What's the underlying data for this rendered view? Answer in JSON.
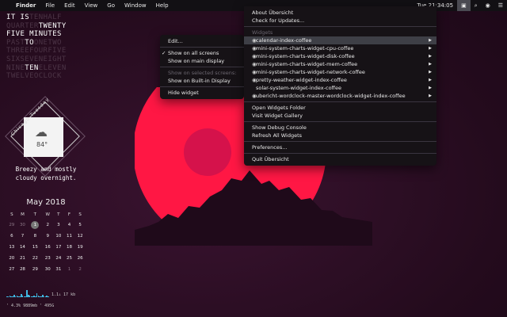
{
  "menubar": {
    "app": "Finder",
    "items": [
      "File",
      "Edit",
      "View",
      "Go",
      "Window",
      "Help"
    ],
    "clock": "Tue 21:34:05"
  },
  "wordclock": {
    "rows": [
      [
        {
          "t": "IT",
          "on": true
        },
        {
          "t": " ",
          "on": false
        },
        {
          "t": "IS",
          "on": true
        },
        {
          "t": "TENHALF",
          "on": false
        }
      ],
      [
        {
          "t": "QUARTER",
          "on": false
        },
        {
          "t": "TWENTY",
          "on": true
        }
      ],
      [
        {
          "t": "FIVE",
          "on": true
        },
        {
          "t": " ",
          "on": false
        },
        {
          "t": "MINUTES",
          "on": true
        }
      ],
      [
        {
          "t": "PAST",
          "on": false
        },
        {
          "t": "TO",
          "on": true
        },
        {
          "t": "ONETWO",
          "on": false
        }
      ],
      [
        {
          "t": "THREEFOURFIVE",
          "on": false
        }
      ],
      [
        {
          "t": "SIXSEVENEIGHT",
          "on": false
        }
      ],
      [
        {
          "t": "NINE",
          "on": false
        },
        {
          "t": "TEN",
          "on": true
        },
        {
          "t": "ELEVEN",
          "on": false
        }
      ],
      [
        {
          "t": "TWELVEOCLOCK",
          "on": false
        }
      ]
    ]
  },
  "weather": {
    "city": "Chicago Tuesday",
    "temp": "84°",
    "summary_line1": "Breezy and mostly",
    "summary_line2": "cloudy overnight."
  },
  "calendar": {
    "title": "May 2018",
    "weekdays": [
      "S",
      "M",
      "T",
      "W",
      "T",
      "F",
      "S"
    ],
    "weeks": [
      [
        {
          "d": "29",
          "dim": true
        },
        {
          "d": "30",
          "dim": true
        },
        {
          "d": "1",
          "today": true
        },
        {
          "d": "2"
        },
        {
          "d": "3"
        },
        {
          "d": "4"
        },
        {
          "d": "5"
        }
      ],
      [
        {
          "d": "6"
        },
        {
          "d": "7"
        },
        {
          "d": "8"
        },
        {
          "d": "9"
        },
        {
          "d": "10"
        },
        {
          "d": "11"
        },
        {
          "d": "12"
        }
      ],
      [
        {
          "d": "13"
        },
        {
          "d": "14"
        },
        {
          "d": "15"
        },
        {
          "d": "16"
        },
        {
          "d": "17"
        },
        {
          "d": "18"
        },
        {
          "d": "19"
        }
      ],
      [
        {
          "d": "20"
        },
        {
          "d": "21"
        },
        {
          "d": "22"
        },
        {
          "d": "23"
        },
        {
          "d": "24"
        },
        {
          "d": "25"
        },
        {
          "d": "26"
        }
      ],
      [
        {
          "d": "27"
        },
        {
          "d": "28"
        },
        {
          "d": "29"
        },
        {
          "d": "30"
        },
        {
          "d": "31"
        },
        {
          "d": "1",
          "dim": true
        },
        {
          "d": "2",
          "dim": true
        }
      ]
    ]
  },
  "system": {
    "net": "1.1↓ 17 kb",
    "stats": "' 4.3%  9889mb  ' 495G"
  },
  "context_menu": {
    "items": [
      {
        "label": "Edit...",
        "type": "item"
      },
      {
        "type": "sep"
      },
      {
        "label": "Show on all screens",
        "type": "item",
        "checked": true
      },
      {
        "label": "Show on main display",
        "type": "item"
      },
      {
        "type": "sep"
      },
      {
        "label": "Show on selected screens:",
        "type": "disabled"
      },
      {
        "label": "Show on Built-in Display",
        "type": "item"
      },
      {
        "type": "sep"
      },
      {
        "label": "Hide widget",
        "type": "item"
      }
    ]
  },
  "main_menu": {
    "items": [
      {
        "label": "About Übersicht",
        "type": "item"
      },
      {
        "label": "Check for Updates...",
        "type": "item"
      },
      {
        "type": "sep"
      },
      {
        "label": "Widgets",
        "type": "disabled"
      },
      {
        "label": "calendar-index-coffee",
        "type": "widget",
        "hl": true,
        "arrow": true
      },
      {
        "label": "mini-system-charts-widget-cpu-coffee",
        "type": "widget",
        "arrow": true
      },
      {
        "label": "mini-system-charts-widget-disk-coffee",
        "type": "widget",
        "arrow": true
      },
      {
        "label": "mini-system-charts-widget-mem-coffee",
        "type": "widget",
        "arrow": true
      },
      {
        "label": "mini-system-charts-widget-network-coffee",
        "type": "widget",
        "arrow": true
      },
      {
        "label": "pretty-weather-widget-index-coffee",
        "type": "widget",
        "arrow": true
      },
      {
        "label": "solar-system-widget-index-coffee",
        "type": "widget-nobullet",
        "arrow": true
      },
      {
        "label": "ubericht-wordclock-master-wordclock-widget-index-coffee",
        "type": "widget",
        "arrow": true
      },
      {
        "type": "sep"
      },
      {
        "label": "Open Widgets Folder",
        "type": "item"
      },
      {
        "label": "Visit Widget Gallery",
        "type": "item"
      },
      {
        "type": "sep"
      },
      {
        "label": "Show Debug Console",
        "type": "item"
      },
      {
        "label": "Refresh All Widgets",
        "type": "item"
      },
      {
        "type": "sep"
      },
      {
        "label": "Preferences...",
        "type": "item"
      },
      {
        "type": "sep"
      },
      {
        "label": "Quit Übersicht",
        "type": "item"
      }
    ]
  },
  "colors": {
    "sun": "#ff1744",
    "accent_blue": "#3fb6e0"
  }
}
